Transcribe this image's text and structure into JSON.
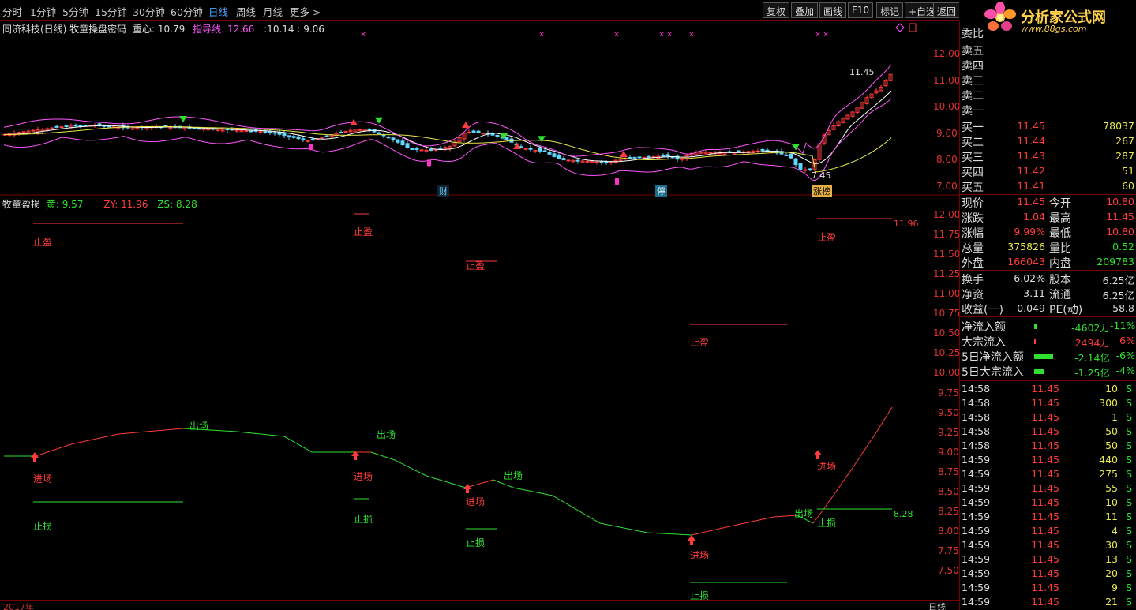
{
  "toolbar": {
    "periods": [
      "分时",
      "1分钟",
      "5分钟",
      "15分钟",
      "30分钟",
      "60分钟",
      "日线",
      "周线",
      "月线",
      "更多 >"
    ],
    "active": "日线",
    "buttons": [
      "复权",
      "叠加",
      "画线",
      "F10",
      "标记",
      "+自选",
      "返回"
    ]
  },
  "logo": {
    "title": "分析家公式网",
    "url": "www.88gs.com"
  },
  "main": {
    "title": "同济科技(日线) 牧童操盘密码",
    "label_zx": "重心:",
    "val_zx": "10.79",
    "label_zd": "指导线:",
    "val_zd": "12.66",
    "tail": ":10.14  : 9.06",
    "y_ticks": [
      "12.00",
      "11.00",
      "10.00",
      "9.00",
      "8.00",
      "7.00"
    ],
    "high_label": "11.45",
    "low_label": "7.45",
    "badges": [
      "财",
      "停",
      "涨榜"
    ]
  },
  "sub": {
    "title": "牧童盈损",
    "label_h": "黄:",
    "val_h": "9.57",
    "label_zy": "ZY:",
    "val_zy": "11.96",
    "label_zs": "ZS:",
    "val_zs": "8.28",
    "y_ticks": [
      "12.00",
      "11.75",
      "11.50",
      "11.25",
      "11.00",
      "10.75",
      "10.50",
      "10.25",
      "10.00",
      "9.75",
      "9.50",
      "9.25",
      "9.00",
      "8.75",
      "8.50",
      "8.25",
      "8.00",
      "7.75",
      "7.50"
    ],
    "zy_right": "11.96",
    "zs_right": "8.28",
    "t_zhiying": "止盈",
    "t_zhisun": "止损",
    "t_jinchang": "进场",
    "t_chuchang": "出场"
  },
  "bottom": {
    "year": "2017年",
    "period": "日线"
  },
  "quote": {
    "wei": "委比",
    "sell": [
      {
        "l": "卖五"
      },
      {
        "l": "卖四"
      },
      {
        "l": "卖三"
      },
      {
        "l": "卖二"
      },
      {
        "l": "卖一"
      }
    ],
    "buy": [
      {
        "l": "买一",
        "p": "11.45",
        "v": "78037"
      },
      {
        "l": "买二",
        "p": "11.44",
        "v": "267"
      },
      {
        "l": "买三",
        "p": "11.43",
        "v": "287"
      },
      {
        "l": "买四",
        "p": "11.42",
        "v": "51"
      },
      {
        "l": "买五",
        "p": "11.41",
        "v": "60"
      }
    ],
    "stats": [
      {
        "l1": "现价",
        "v1": "11.45",
        "l2": "今开",
        "v2": "10.80"
      },
      {
        "l1": "涨跌",
        "v1": "1.04",
        "l2": "最高",
        "v2": "11.45"
      },
      {
        "l1": "涨幅",
        "v1": "9.99%",
        "l2": "最低",
        "v2": "10.80"
      },
      {
        "l1": "总量",
        "v1": "375826",
        "l2": "量比",
        "v2": "0.52"
      },
      {
        "l1": "外盘",
        "v1": "166043",
        "l2": "内盘",
        "v2": "209783"
      }
    ],
    "fin": [
      {
        "l1": "换手",
        "v1": "6.02%",
        "l2": "股本",
        "v2": "6.25亿"
      },
      {
        "l1": "净资",
        "v1": "3.11",
        "l2": "流通",
        "v2": "6.25亿"
      },
      {
        "l1": "收益(一)",
        "v1": "0.049",
        "l2": "PE(动)",
        "v2": "58.8"
      }
    ],
    "flow": [
      {
        "l": "净流入额",
        "v": "-4602万",
        "p": "-11%"
      },
      {
        "l": "大宗流入",
        "v": "2494万",
        "p": "6%"
      },
      {
        "l": "5日净流入额",
        "v": "-2.14亿",
        "p": "-6%"
      },
      {
        "l": "5日大宗流入",
        "v": "-1.25亿",
        "p": "-4%"
      }
    ],
    "ticks": [
      {
        "t": "14:58",
        "p": "11.45",
        "v": "10",
        "s": "S"
      },
      {
        "t": "14:58",
        "p": "11.45",
        "v": "300",
        "s": "S"
      },
      {
        "t": "14:58",
        "p": "11.45",
        "v": "1",
        "s": "S"
      },
      {
        "t": "14:58",
        "p": "11.45",
        "v": "50",
        "s": "S"
      },
      {
        "t": "14:58",
        "p": "11.45",
        "v": "50",
        "s": "S"
      },
      {
        "t": "14:59",
        "p": "11.45",
        "v": "440",
        "s": "S"
      },
      {
        "t": "14:59",
        "p": "11.45",
        "v": "275",
        "s": "S"
      },
      {
        "t": "14:59",
        "p": "11.45",
        "v": "55",
        "s": "S"
      },
      {
        "t": "14:59",
        "p": "11.45",
        "v": "10",
        "s": "S"
      },
      {
        "t": "14:59",
        "p": "11.45",
        "v": "11",
        "s": "S"
      },
      {
        "t": "14:59",
        "p": "11.45",
        "v": "4",
        "s": "S"
      },
      {
        "t": "14:59",
        "p": "11.45",
        "v": "30",
        "s": "S"
      },
      {
        "t": "14:59",
        "p": "11.45",
        "v": "13",
        "s": "S"
      },
      {
        "t": "14:59",
        "p": "11.45",
        "v": "20",
        "s": "S"
      },
      {
        "t": "14:59",
        "p": "11.45",
        "v": "9",
        "s": "S"
      },
      {
        "t": "14:59",
        "p": "11.45",
        "v": "21",
        "s": "S"
      }
    ]
  },
  "colors": {
    "up": "#ff3b3b",
    "down": "#5fd8ff",
    "ma1": "#ffffff",
    "ma2": "#e8e84b",
    "band": "#ff55ff",
    "green": "#2fe02f",
    "grid": "#7a0000"
  }
}
